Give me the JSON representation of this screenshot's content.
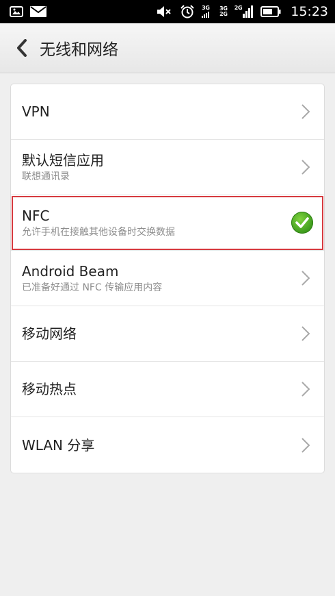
{
  "status_bar": {
    "left_icons": [
      "image-icon",
      "mail-icon"
    ],
    "right_icons": [
      "mute-icon",
      "alarm-icon",
      "3g-signal-icon",
      "3g-2g-signal-icon",
      "2g-signal-icon",
      "battery-icon"
    ],
    "net_labels": [
      "3G",
      "3G",
      "2G",
      "2G"
    ],
    "time": "15:23"
  },
  "header": {
    "title": "无线和网络"
  },
  "settings": {
    "items": [
      {
        "title": "VPN",
        "subtitle": "",
        "control": "chevron"
      },
      {
        "title": "默认短信应用",
        "subtitle": "联想通讯录",
        "control": "chevron"
      },
      {
        "title": "NFC",
        "subtitle": "允许手机在接触其他设备时交换数据",
        "control": "checked"
      },
      {
        "title": "Android Beam",
        "subtitle": "已准备好通过 NFC 传输应用内容",
        "control": "chevron"
      },
      {
        "title": "移动网络",
        "subtitle": "",
        "control": "chevron"
      },
      {
        "title": "移动热点",
        "subtitle": "",
        "control": "chevron"
      },
      {
        "title": "WLAN 分享",
        "subtitle": "",
        "control": "chevron"
      }
    ]
  },
  "colors": {
    "accent_check": "#4caf27",
    "highlight_border": "#d63a3f",
    "status_bar_bg": "#000000"
  }
}
